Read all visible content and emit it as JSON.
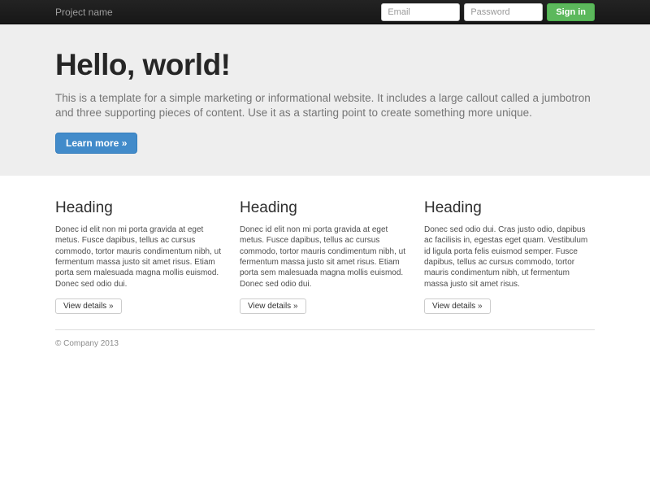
{
  "navbar": {
    "brand": "Project name",
    "email_placeholder": "Email",
    "password_placeholder": "Password",
    "signin_label": "Sign in"
  },
  "jumbotron": {
    "title": "Hello, world!",
    "description": "This is a template for a simple marketing or informational website. It includes a large callout called a jumbotron and three supporting pieces of content. Use it as a starting point to create something more unique.",
    "cta_label": "Learn more »"
  },
  "columns": [
    {
      "heading": "Heading",
      "body": "Donec id elit non mi porta gravida at eget metus. Fusce dapibus, tellus ac cursus commodo, tortor mauris condimentum nibh, ut fermentum massa justo sit amet risus. Etiam porta sem malesuada magna mollis euismod. Donec sed odio dui.",
      "button_label": "View details »"
    },
    {
      "heading": "Heading",
      "body": "Donec id elit non mi porta gravida at eget metus. Fusce dapibus, tellus ac cursus commodo, tortor mauris condimentum nibh, ut fermentum massa justo sit amet risus. Etiam porta sem malesuada magna mollis euismod. Donec sed odio dui.",
      "button_label": "View details »"
    },
    {
      "heading": "Heading",
      "body": "Donec sed odio dui. Cras justo odio, dapibus ac facilisis in, egestas eget quam. Vestibulum id ligula porta felis euismod semper. Fusce dapibus, tellus ac cursus commodo, tortor mauris condimentum nibh, ut fermentum massa justo sit amet risus.",
      "button_label": "View details »"
    }
  ],
  "footer": {
    "copyright": "© Company 2013"
  },
  "colors": {
    "navbar_bg": "#1b1b1b",
    "jumbotron_bg": "#eeeeee",
    "primary_button": "#428bca",
    "signin_button": "#5cb85c"
  }
}
